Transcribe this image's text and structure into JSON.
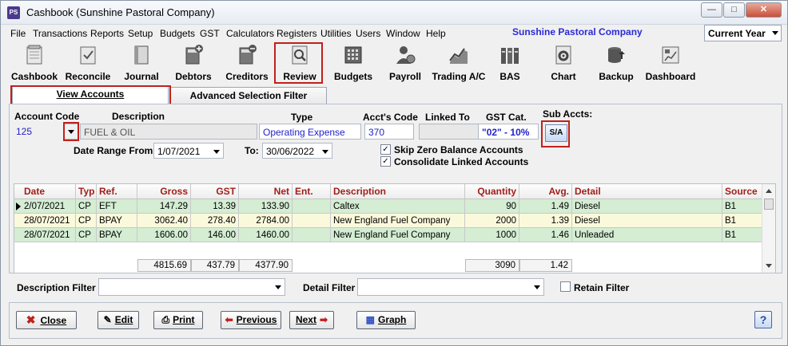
{
  "window": {
    "title": "Cashbook (Sunshine Pastoral Company)",
    "icon_text": "PS"
  },
  "menu": {
    "items": [
      "File",
      "Transactions",
      "Reports",
      "Setup",
      "Budgets",
      "GST",
      "Calculators",
      "Registers",
      "Utilities",
      "Users",
      "Window",
      "Help"
    ],
    "company": "Sunshine Pastoral Company",
    "period": "Current Year"
  },
  "toolbar": [
    "Cashbook",
    "Reconcile",
    "Journal",
    "Debtors",
    "Creditors",
    "Review",
    "Budgets",
    "Payroll",
    "Trading A/C",
    "BAS",
    "Chart",
    "Backup",
    "Dashboard"
  ],
  "tabs": [
    "View Accounts",
    "Advanced Selection Filter"
  ],
  "form": {
    "account_code_label": "Account Code",
    "account_code": "125",
    "description_label": "Description",
    "description": "FUEL & OIL",
    "type_label": "Type",
    "type": "Operating Expense",
    "accts_code_label": "Acct's Code",
    "accts_code": "370",
    "linked_to_label": "Linked To",
    "linked_to": "",
    "gst_cat_label": "GST Cat.",
    "gst_cat": "\"02\" - 10%",
    "sub_accts_label": "Sub Accts:",
    "sub_accts_button": "S/A",
    "date_from_label": "Date Range From:",
    "date_from": "1/07/2021",
    "date_to_label": "To:",
    "date_to": "30/06/2022",
    "skip_zero_label": "Skip Zero Balance Accounts",
    "consolidate_label": "Consolidate Linked Accounts",
    "skip_zero_checked": "✓",
    "consolidate_checked": "✓"
  },
  "grid": {
    "columns": [
      "Date",
      "Typ",
      "Ref.",
      "Gross",
      "GST",
      "Net",
      "Ent.",
      "Description",
      "Quantity",
      "Avg.",
      "Detail",
      "Source"
    ],
    "rows": [
      {
        "date": "2/07/2021",
        "typ": "CP",
        "ref": "EFT",
        "gross": "147.29",
        "gst": "13.39",
        "net": "133.90",
        "ent": "",
        "desc": "Caltex",
        "qty": "90",
        "avg": "1.49",
        "detail": "Diesel",
        "source": "B1"
      },
      {
        "date": "28/07/2021",
        "typ": "CP",
        "ref": "BPAY",
        "gross": "3062.40",
        "gst": "278.40",
        "net": "2784.00",
        "ent": "",
        "desc": "New England Fuel Company",
        "qty": "2000",
        "avg": "1.39",
        "detail": "Diesel",
        "source": "B1"
      },
      {
        "date": "28/07/2021",
        "typ": "CP",
        "ref": "BPAY",
        "gross": "1606.00",
        "gst": "146.00",
        "net": "1460.00",
        "ent": "",
        "desc": "New England Fuel Company",
        "qty": "1000",
        "avg": "1.46",
        "detail": "Unleaded",
        "source": "B1"
      }
    ],
    "totals": {
      "gross": "4815.69",
      "gst": "437.79",
      "net": "4377.90",
      "qty": "3090",
      "avg": "1.42"
    }
  },
  "filters": {
    "description_label": "Description Filter",
    "detail_label": "Detail Filter",
    "retain_label": "Retain Filter",
    "description_value": "",
    "detail_value": ""
  },
  "buttons": {
    "close": "Close",
    "edit": "Edit",
    "print": "Print",
    "previous": "Previous",
    "next": "Next",
    "graph": "Graph",
    "help": "?"
  },
  "colors": {
    "header_text": "#a0201a",
    "row_green": "#d4edd3",
    "row_yellow": "#fbf9dc",
    "highlight": "#c0201a",
    "blue_text": "#2222cc"
  }
}
